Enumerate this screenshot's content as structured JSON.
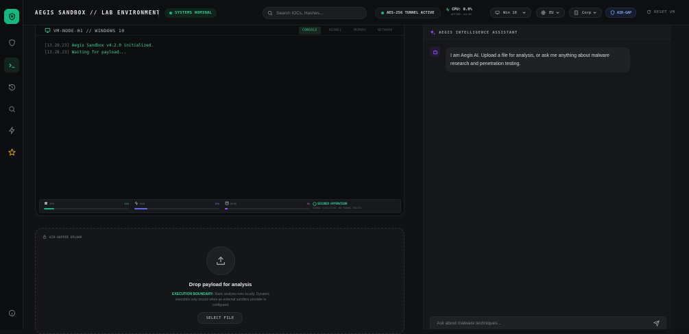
{
  "header": {
    "title": "AEGIS SANDBOX // LAB ENVIRONMENT",
    "status": "SYSTEMS NOMINAL",
    "search_placeholder": "Search IOCs, Hashes...",
    "tunnel": "AES-256 TUNNEL ACTIVE",
    "cpu_label": "CPU: 0.0%",
    "uptime": "UPTIME: 04:38",
    "os_select": "Win 10",
    "region_select": "EU",
    "profile_select": "Corp",
    "airgap": "AIR-GAP",
    "reset": "RESET VM"
  },
  "console": {
    "vm_name": "VM-NODE-01 // WINDOWS 10",
    "tabs": [
      "CONSOLE",
      "KERNEL",
      "MEMORY",
      "NETWORK"
    ],
    "logs": [
      {
        "ts": "[13.28.23]",
        "msg": "Aegis Sandbox v4.2.0 initialized."
      },
      {
        "ts": "[13.28.23]",
        "msg": "Waiting for payload..."
      }
    ],
    "metrics": {
      "cpu_label": "CPU",
      "cpu_value": "12%",
      "cpu_pct": 12,
      "ram_label": "RAM",
      "ram_value": "15%",
      "ram_pct": 15,
      "disk_label": "DISK",
      "disk_value": "3%",
      "disk_pct": 3
    },
    "hypervisor_title": "SECURED HYPERVISOR",
    "hypervisor_sub": "GLOBAL ISOLATION: NO TUNNEL ROUTES"
  },
  "upload": {
    "label": "AIR-GAPPED UPLOAD",
    "title": "Drop payload for analysis",
    "boundary": "EXECUTION BOUNDARY:",
    "desc": "Static analysis runs locally. Dynamic execution only occurs when an external sandbox provider is configured.",
    "button": "SELECT FILE"
  },
  "assistant": {
    "title": "AEGIS INTELLIGENCE ASSISTANT",
    "message": "I am Aegis AI. Upload a file for analysis, or ask me anything about malware research and penetration testing.",
    "input_placeholder": "Ask about malware techniques..."
  },
  "colors": {
    "accent": "#10b981",
    "ram": "#6366f1",
    "disk": "#a855f7",
    "bot": "#a855f7"
  }
}
